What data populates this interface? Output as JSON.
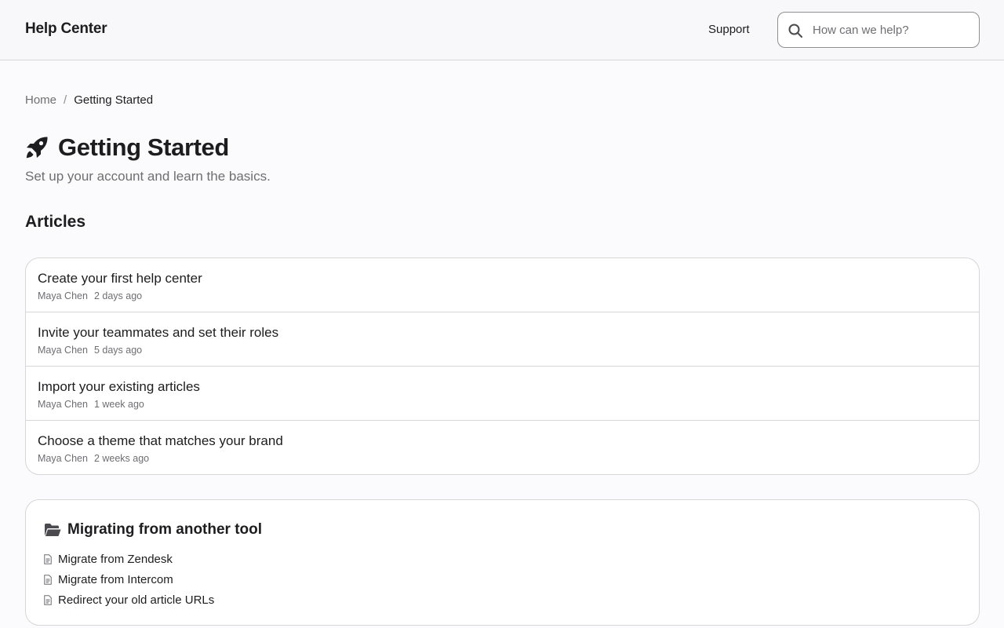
{
  "header": {
    "brand": "Help Center",
    "support_label": "Support",
    "search": {
      "placeholder": "How can we help?",
      "value": "",
      "icon": "search-icon"
    }
  },
  "breadcrumb": {
    "home": "Home",
    "separator": "/",
    "current": "Getting Started"
  },
  "page": {
    "icon": "rocket-icon",
    "title": "Getting Started",
    "subtitle": "Set up your account and learn the basics."
  },
  "articles": {
    "heading": "Articles",
    "items": [
      {
        "title": "Create your first help center",
        "author": "Maya Chen",
        "time": "2 days ago"
      },
      {
        "title": "Invite your teammates and set their roles",
        "author": "Maya Chen",
        "time": "5 days ago"
      },
      {
        "title": "Import your existing articles",
        "author": "Maya Chen",
        "time": "1 week ago"
      },
      {
        "title": "Choose a theme that matches your brand",
        "author": "Maya Chen",
        "time": "2 weeks ago"
      }
    ]
  },
  "section": {
    "icon": "folder-open-icon",
    "title": "Migrating from another tool",
    "items": [
      {
        "label": "Migrate from Zendesk",
        "icon": "document-icon"
      },
      {
        "label": "Migrate from Intercom",
        "icon": "document-icon"
      },
      {
        "label": "Redirect your old article URLs",
        "icon": "document-icon"
      }
    ]
  },
  "colors": {
    "background": "#fbfbfd",
    "header_background": "#f8f8fa",
    "text": "#1d1d1f",
    "muted_text": "#6e6e73",
    "border": "#d6d6da"
  }
}
